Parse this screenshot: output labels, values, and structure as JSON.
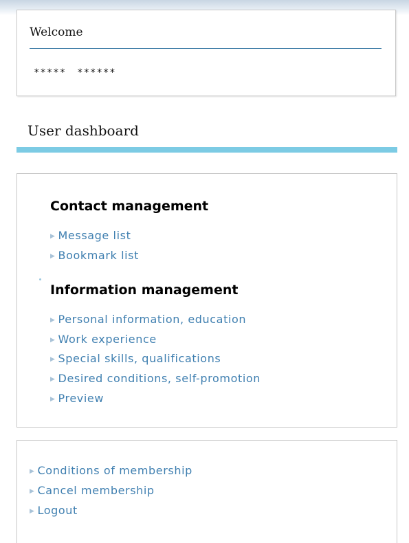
{
  "welcome": {
    "title": "Welcome",
    "name_first": "*****",
    "name_last": "******"
  },
  "dashboard": {
    "title": "User dashboard"
  },
  "contact_management": {
    "heading": "Contact management",
    "links": [
      "Message list",
      "Bookmark list"
    ]
  },
  "information_management": {
    "heading": "Information management",
    "links": [
      "Personal information, education",
      "Work experience",
      "Special skills, qualifications",
      "Desired conditions, self-promotion",
      "Preview"
    ]
  },
  "account": {
    "links": [
      "Conditions of membership",
      "Cancel membership",
      "Logout"
    ]
  },
  "colors": {
    "link": "#3f7fb0",
    "accent_bar": "#7ccbe4",
    "rule": "#3b7ba6"
  },
  "icons": {
    "bullet": "triangle-bullet-icon"
  }
}
